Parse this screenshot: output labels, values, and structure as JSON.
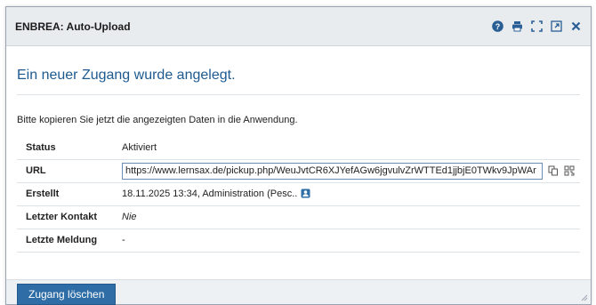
{
  "dialog": {
    "title": "ENBREA: Auto-Upload",
    "tools": [
      "help-icon",
      "print-icon",
      "fullscreen-icon",
      "external-window-icon",
      "close-icon"
    ]
  },
  "content": {
    "headline": "Ein neuer Zugang wurde angelegt.",
    "intro": "Bitte kopieren Sie jetzt die angezeigten Daten in die Anwendung.",
    "rows": {
      "status": {
        "label": "Status",
        "value": "Aktiviert"
      },
      "url": {
        "label": "URL",
        "value": "https://www.lernsax.de/pickup.php/WeuJvtCR6XJYefAGw6jgvulvZrWTTEd1jjbjE0TWkv9JpWAr"
      },
      "erstellt": {
        "label": "Erstellt",
        "value": "18.11.2025 13:34, Administration (Pesc.."
      },
      "kontakt": {
        "label": "Letzter Kontakt",
        "value": "Nie"
      },
      "meldung": {
        "label": "Letzte Meldung",
        "value": "-"
      }
    }
  },
  "footer": {
    "delete_label": "Zugang löschen"
  },
  "colors": {
    "accent": "#2e6da6",
    "headline": "#1d5a8f",
    "titlebar": "#e9ecef"
  }
}
